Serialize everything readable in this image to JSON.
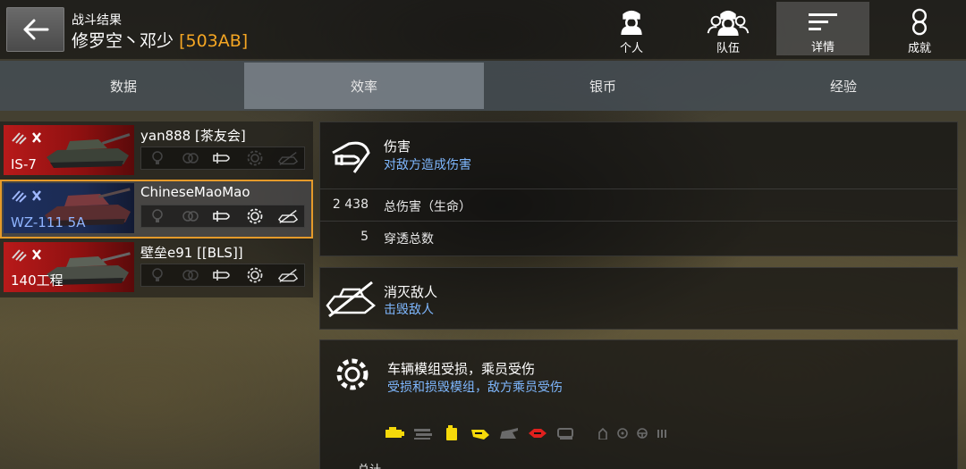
{
  "header": {
    "subtitle": "战斗结果",
    "player": "修罗空丶邓少",
    "clan": "[503AB]",
    "nav": [
      {
        "label": "个人",
        "icon": "personal-icon"
      },
      {
        "label": "队伍",
        "icon": "team-icon"
      },
      {
        "label": "详情",
        "icon": "details-icon",
        "active": true
      },
      {
        "label": "成就",
        "icon": "medal-icon"
      }
    ]
  },
  "tabs": [
    {
      "label": "数据"
    },
    {
      "label": "效率",
      "active": true
    },
    {
      "label": "银币"
    },
    {
      "label": "经验"
    }
  ],
  "players": [
    {
      "name": "yan888 [茶友会]",
      "tank": "IS-7",
      "tier": "X",
      "selected": false
    },
    {
      "name": "ChineseMaoMao",
      "tank": "WZ-111 5A",
      "tier": "X",
      "selected": true
    },
    {
      "name": "壁垒e91 [[BLS]]",
      "tank": "140工程",
      "tier": "X",
      "selected": false
    }
  ],
  "damage": {
    "title": "伤害",
    "desc": "对敌方造成伤害",
    "rows": [
      {
        "value": "2 438",
        "label": "总伤害（生命）"
      },
      {
        "value": "5",
        "label": "穿透总数"
      }
    ]
  },
  "destroy": {
    "title": "消灭敌人",
    "desc": "击毁敌人"
  },
  "modules": {
    "title": "车辆模组受损，乘员受伤",
    "desc": "受损和损毁模组，敌方乘员受伤",
    "icons": [
      "engine-icon",
      "tracks-icon",
      "fuel-tank-icon",
      "gun-icon",
      "turret-icon",
      "ammo-rack-icon",
      "observation-icon",
      "commander-icon",
      "gunner-icon",
      "driver-icon",
      "loader-icon"
    ],
    "colors": {
      "active": "#f5d90a",
      "red": "#e0201e",
      "inactive": "#7a7a7a"
    },
    "cut_text": "总计"
  }
}
